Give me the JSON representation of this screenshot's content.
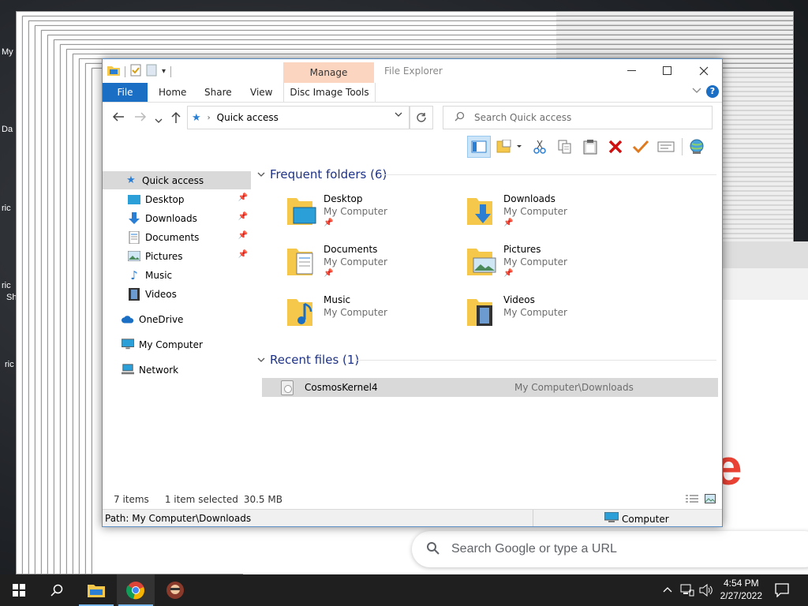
{
  "desktop": {
    "labels": [
      "My",
      "Da",
      "ric",
      "ric",
      "Sh",
      "ric"
    ]
  },
  "chrome": {
    "search_placeholder": "Search Google or type a URL",
    "logo_letter": "e"
  },
  "explorer": {
    "title": "File Explorer",
    "contextual_tab_group": "Manage",
    "tabs": {
      "file": "File",
      "home": "Home",
      "share": "Share",
      "view": "View",
      "disc": "Disc Image Tools"
    },
    "address": "Quick access",
    "search_placeholder": "Search Quick access",
    "help": "?",
    "sidebar": {
      "quick_access": "Quick access",
      "desktop": "Desktop",
      "downloads": "Downloads",
      "documents": "Documents",
      "pictures": "Pictures",
      "music": "Music",
      "videos": "Videos",
      "onedrive": "OneDrive",
      "my_computer": "My Computer",
      "network": "Network"
    },
    "frequent_header": "Frequent folders (6)",
    "folders": [
      {
        "name": "Desktop",
        "location": "My Computer"
      },
      {
        "name": "Downloads",
        "location": "My Computer"
      },
      {
        "name": "Documents",
        "location": "My Computer"
      },
      {
        "name": "Pictures",
        "location": "My Computer"
      },
      {
        "name": "Music",
        "location": "My Computer"
      },
      {
        "name": "Videos",
        "location": "My Computer"
      }
    ],
    "recent_header": "Recent files (1)",
    "recent": [
      {
        "name": "CosmosKernel4",
        "location": "My Computer\\Downloads"
      }
    ],
    "status": {
      "items": "7 items",
      "selected": "1 item selected",
      "size": "30.5 MB"
    },
    "path": "Path: My Computer\\Downloads",
    "computer": "Computer"
  },
  "taskbar": {
    "time": "4:54 PM",
    "date": "2/27/2022"
  },
  "colors": {
    "accent": "#1a6ec4",
    "manage_tab": "#fbd5bf",
    "selection": "#d9d9d9",
    "section_header": "#1e3287",
    "folder_yellow": "#f5c84c"
  }
}
